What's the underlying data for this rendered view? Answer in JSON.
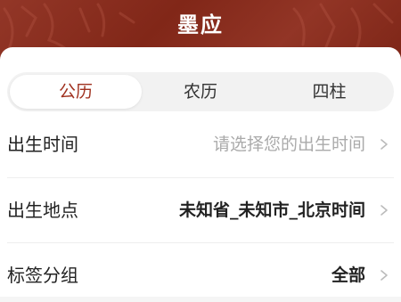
{
  "header": {
    "title": "墨应"
  },
  "tabs": [
    {
      "label": "公历",
      "active": true
    },
    {
      "label": "农历",
      "active": false
    },
    {
      "label": "四柱",
      "active": false
    }
  ],
  "form": {
    "birth_time": {
      "label": "出生时间",
      "placeholder": "请选择您的出生时间"
    },
    "birth_place": {
      "label": "出生地点",
      "value": "未知省_未知市_北京时间"
    },
    "tag_group": {
      "label": "标签分组",
      "value": "全部"
    }
  },
  "colors": {
    "header_bg": "#8c2a1a",
    "accent": "#a0311f",
    "placeholder": "#aaaaaa"
  }
}
